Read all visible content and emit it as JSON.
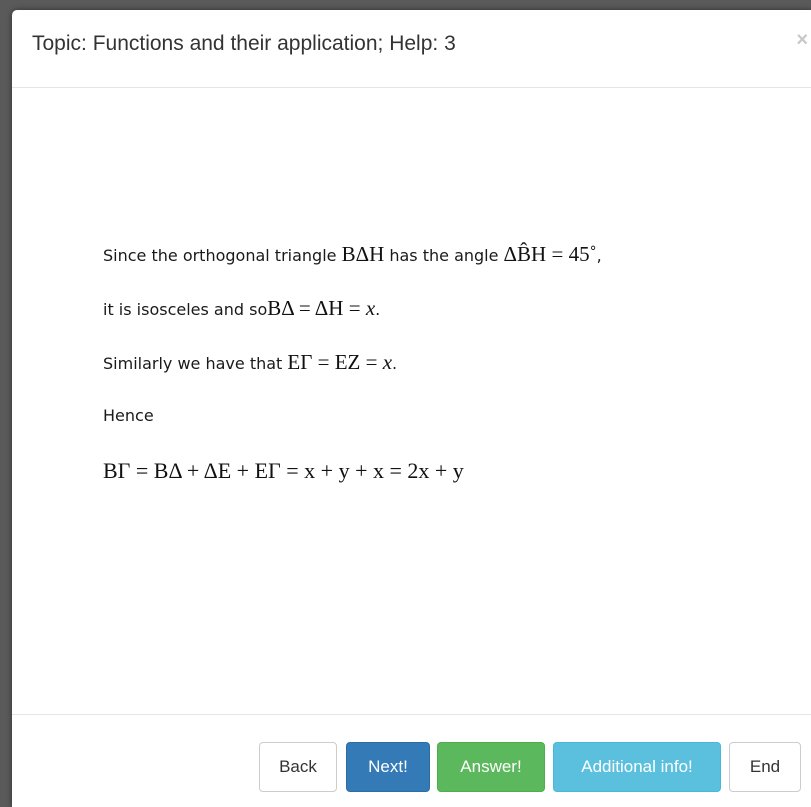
{
  "dialog": {
    "title": "Topic: Functions and their application; Help: 3",
    "close_symbol": "×"
  },
  "content": {
    "line1": {
      "prefix": "Since the orthogonal triangle ",
      "triangle": "BΔH",
      "middle": " has the angle ",
      "angle_expr": "ΔB̂H = 45˚",
      "suffix": ","
    },
    "line2": {
      "prefix": " it is isosceles and so",
      "expr_lhs": "BΔ = ΔH = ",
      "expr_var": "x",
      "suffix": "."
    },
    "line3": {
      "prefix": "Similarly we have that ",
      "expr_lhs": "EΓ = EZ = ",
      "expr_var": "x",
      "suffix": "."
    },
    "line4": {
      "text": "Hence"
    },
    "line5": {
      "expr": "BΓ = BΔ + ΔE + EΓ = x + y + x = 2x + y"
    }
  },
  "footer": {
    "back_label": "Back",
    "next_label": "Next!",
    "answer_label": "Answer!",
    "info_label": "Additional info!",
    "end_label": "End"
  },
  "colors": {
    "primary": "#337ab7",
    "success": "#5cb85c",
    "info": "#5bc0de"
  }
}
